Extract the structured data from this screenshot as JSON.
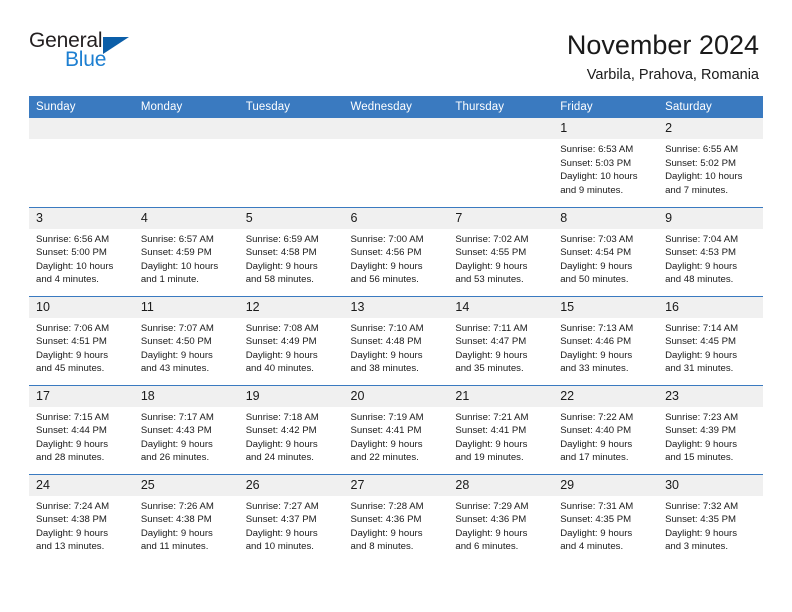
{
  "brand": {
    "word1": "General",
    "word2": "Blue",
    "triangle_color": "#0b5ea8",
    "blue_color": "#1d7fd1"
  },
  "header": {
    "title": "November 2024",
    "subtitle": "Varbila, Prahova, Romania",
    "header_bg": "#3a7ac0",
    "header_text_color": "#ffffff",
    "daynum_bg": "#f0f0f0"
  },
  "weekday_headers": [
    "Sunday",
    "Monday",
    "Tuesday",
    "Wednesday",
    "Thursday",
    "Friday",
    "Saturday"
  ],
  "labels": {
    "sunrise": "Sunrise:",
    "sunset": "Sunset:",
    "daylight": "Daylight:"
  },
  "weeks": [
    [
      {
        "day": "",
        "empty": true,
        "sunrise": "",
        "sunset": "",
        "daylight1": "",
        "daylight2": ""
      },
      {
        "day": "",
        "empty": true,
        "sunrise": "",
        "sunset": "",
        "daylight1": "",
        "daylight2": ""
      },
      {
        "day": "",
        "empty": true,
        "sunrise": "",
        "sunset": "",
        "daylight1": "",
        "daylight2": ""
      },
      {
        "day": "",
        "empty": true,
        "sunrise": "",
        "sunset": "",
        "daylight1": "",
        "daylight2": ""
      },
      {
        "day": "",
        "empty": true,
        "sunrise": "",
        "sunset": "",
        "daylight1": "",
        "daylight2": ""
      },
      {
        "day": "1",
        "empty": false,
        "sunrise": "Sunrise: 6:53 AM",
        "sunset": "Sunset: 5:03 PM",
        "daylight1": "Daylight: 10 hours",
        "daylight2": "and 9 minutes."
      },
      {
        "day": "2",
        "empty": false,
        "sunrise": "Sunrise: 6:55 AM",
        "sunset": "Sunset: 5:02 PM",
        "daylight1": "Daylight: 10 hours",
        "daylight2": "and 7 minutes."
      }
    ],
    [
      {
        "day": "3",
        "empty": false,
        "sunrise": "Sunrise: 6:56 AM",
        "sunset": "Sunset: 5:00 PM",
        "daylight1": "Daylight: 10 hours",
        "daylight2": "and 4 minutes."
      },
      {
        "day": "4",
        "empty": false,
        "sunrise": "Sunrise: 6:57 AM",
        "sunset": "Sunset: 4:59 PM",
        "daylight1": "Daylight: 10 hours",
        "daylight2": "and 1 minute."
      },
      {
        "day": "5",
        "empty": false,
        "sunrise": "Sunrise: 6:59 AM",
        "sunset": "Sunset: 4:58 PM",
        "daylight1": "Daylight: 9 hours",
        "daylight2": "and 58 minutes."
      },
      {
        "day": "6",
        "empty": false,
        "sunrise": "Sunrise: 7:00 AM",
        "sunset": "Sunset: 4:56 PM",
        "daylight1": "Daylight: 9 hours",
        "daylight2": "and 56 minutes."
      },
      {
        "day": "7",
        "empty": false,
        "sunrise": "Sunrise: 7:02 AM",
        "sunset": "Sunset: 4:55 PM",
        "daylight1": "Daylight: 9 hours",
        "daylight2": "and 53 minutes."
      },
      {
        "day": "8",
        "empty": false,
        "sunrise": "Sunrise: 7:03 AM",
        "sunset": "Sunset: 4:54 PM",
        "daylight1": "Daylight: 9 hours",
        "daylight2": "and 50 minutes."
      },
      {
        "day": "9",
        "empty": false,
        "sunrise": "Sunrise: 7:04 AM",
        "sunset": "Sunset: 4:53 PM",
        "daylight1": "Daylight: 9 hours",
        "daylight2": "and 48 minutes."
      }
    ],
    [
      {
        "day": "10",
        "empty": false,
        "sunrise": "Sunrise: 7:06 AM",
        "sunset": "Sunset: 4:51 PM",
        "daylight1": "Daylight: 9 hours",
        "daylight2": "and 45 minutes."
      },
      {
        "day": "11",
        "empty": false,
        "sunrise": "Sunrise: 7:07 AM",
        "sunset": "Sunset: 4:50 PM",
        "daylight1": "Daylight: 9 hours",
        "daylight2": "and 43 minutes."
      },
      {
        "day": "12",
        "empty": false,
        "sunrise": "Sunrise: 7:08 AM",
        "sunset": "Sunset: 4:49 PM",
        "daylight1": "Daylight: 9 hours",
        "daylight2": "and 40 minutes."
      },
      {
        "day": "13",
        "empty": false,
        "sunrise": "Sunrise: 7:10 AM",
        "sunset": "Sunset: 4:48 PM",
        "daylight1": "Daylight: 9 hours",
        "daylight2": "and 38 minutes."
      },
      {
        "day": "14",
        "empty": false,
        "sunrise": "Sunrise: 7:11 AM",
        "sunset": "Sunset: 4:47 PM",
        "daylight1": "Daylight: 9 hours",
        "daylight2": "and 35 minutes."
      },
      {
        "day": "15",
        "empty": false,
        "sunrise": "Sunrise: 7:13 AM",
        "sunset": "Sunset: 4:46 PM",
        "daylight1": "Daylight: 9 hours",
        "daylight2": "and 33 minutes."
      },
      {
        "day": "16",
        "empty": false,
        "sunrise": "Sunrise: 7:14 AM",
        "sunset": "Sunset: 4:45 PM",
        "daylight1": "Daylight: 9 hours",
        "daylight2": "and 31 minutes."
      }
    ],
    [
      {
        "day": "17",
        "empty": false,
        "sunrise": "Sunrise: 7:15 AM",
        "sunset": "Sunset: 4:44 PM",
        "daylight1": "Daylight: 9 hours",
        "daylight2": "and 28 minutes."
      },
      {
        "day": "18",
        "empty": false,
        "sunrise": "Sunrise: 7:17 AM",
        "sunset": "Sunset: 4:43 PM",
        "daylight1": "Daylight: 9 hours",
        "daylight2": "and 26 minutes."
      },
      {
        "day": "19",
        "empty": false,
        "sunrise": "Sunrise: 7:18 AM",
        "sunset": "Sunset: 4:42 PM",
        "daylight1": "Daylight: 9 hours",
        "daylight2": "and 24 minutes."
      },
      {
        "day": "20",
        "empty": false,
        "sunrise": "Sunrise: 7:19 AM",
        "sunset": "Sunset: 4:41 PM",
        "daylight1": "Daylight: 9 hours",
        "daylight2": "and 22 minutes."
      },
      {
        "day": "21",
        "empty": false,
        "sunrise": "Sunrise: 7:21 AM",
        "sunset": "Sunset: 4:41 PM",
        "daylight1": "Daylight: 9 hours",
        "daylight2": "and 19 minutes."
      },
      {
        "day": "22",
        "empty": false,
        "sunrise": "Sunrise: 7:22 AM",
        "sunset": "Sunset: 4:40 PM",
        "daylight1": "Daylight: 9 hours",
        "daylight2": "and 17 minutes."
      },
      {
        "day": "23",
        "empty": false,
        "sunrise": "Sunrise: 7:23 AM",
        "sunset": "Sunset: 4:39 PM",
        "daylight1": "Daylight: 9 hours",
        "daylight2": "and 15 minutes."
      }
    ],
    [
      {
        "day": "24",
        "empty": false,
        "sunrise": "Sunrise: 7:24 AM",
        "sunset": "Sunset: 4:38 PM",
        "daylight1": "Daylight: 9 hours",
        "daylight2": "and 13 minutes."
      },
      {
        "day": "25",
        "empty": false,
        "sunrise": "Sunrise: 7:26 AM",
        "sunset": "Sunset: 4:38 PM",
        "daylight1": "Daylight: 9 hours",
        "daylight2": "and 11 minutes."
      },
      {
        "day": "26",
        "empty": false,
        "sunrise": "Sunrise: 7:27 AM",
        "sunset": "Sunset: 4:37 PM",
        "daylight1": "Daylight: 9 hours",
        "daylight2": "and 10 minutes."
      },
      {
        "day": "27",
        "empty": false,
        "sunrise": "Sunrise: 7:28 AM",
        "sunset": "Sunset: 4:36 PM",
        "daylight1": "Daylight: 9 hours",
        "daylight2": "and 8 minutes."
      },
      {
        "day": "28",
        "empty": false,
        "sunrise": "Sunrise: 7:29 AM",
        "sunset": "Sunset: 4:36 PM",
        "daylight1": "Daylight: 9 hours",
        "daylight2": "and 6 minutes."
      },
      {
        "day": "29",
        "empty": false,
        "sunrise": "Sunrise: 7:31 AM",
        "sunset": "Sunset: 4:35 PM",
        "daylight1": "Daylight: 9 hours",
        "daylight2": "and 4 minutes."
      },
      {
        "day": "30",
        "empty": false,
        "sunrise": "Sunrise: 7:32 AM",
        "sunset": "Sunset: 4:35 PM",
        "daylight1": "Daylight: 9 hours",
        "daylight2": "and 3 minutes."
      }
    ]
  ]
}
